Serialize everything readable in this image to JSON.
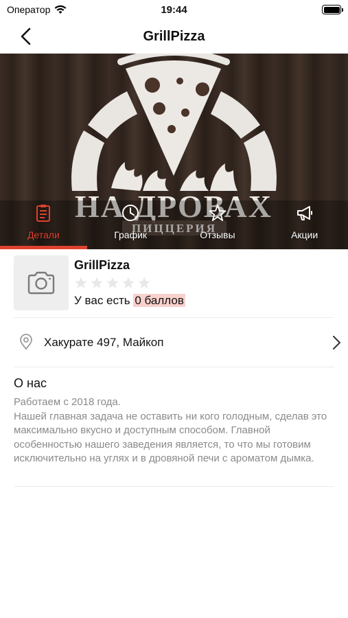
{
  "status_bar": {
    "carrier": "Оператор",
    "time": "19:44"
  },
  "nav": {
    "title": "GrillPizza",
    "back_icon": "chevron-left-icon"
  },
  "hero": {
    "brand_text": "НА ДРОВАХ",
    "brand_subtext": "ПИЦЦЕРИЯ"
  },
  "tabs": [
    {
      "label": "Детали",
      "icon": "clipboard-icon",
      "active": true
    },
    {
      "label": "График",
      "icon": "clock-icon",
      "active": false
    },
    {
      "label": "Отзывы",
      "icon": "star-icon",
      "active": false
    },
    {
      "label": "Акции",
      "icon": "megaphone-icon",
      "active": false
    }
  ],
  "business": {
    "name": "GrillPizza",
    "rating": 0,
    "rating_max": 5,
    "points_prefix": "У вас есть ",
    "points_value": "0 баллов"
  },
  "address": {
    "text": "Хакурате 497, Майкоп"
  },
  "about": {
    "title": "О нас",
    "text": "Работаем с 2018 года.\nНашей главная задача не оставить ни кого голодным, сделав это максимально вкусно и доступным способом. Главной особенностью нашего заведения является, то что мы  готовим исключительно на углях и в дровяной печи с ароматом дымка."
  },
  "colors": {
    "accent": "#e0412e",
    "highlight": "#f8d0cc",
    "muted_text": "#8a8a8a"
  }
}
